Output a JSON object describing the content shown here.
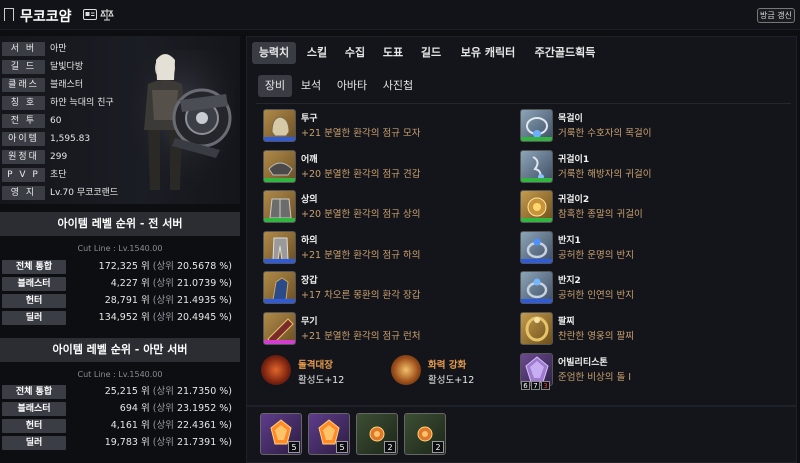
{
  "header": {
    "title": "무코코얌",
    "refresh_label": "방금 갱신"
  },
  "profile": {
    "rows": [
      {
        "label": "서 버",
        "value": "아만"
      },
      {
        "label": "길 드",
        "value": "달빛다방"
      },
      {
        "label": "클래스",
        "value": "블래스터"
      },
      {
        "label": "칭 호",
        "value": "하얀 늑대의 친구"
      },
      {
        "label": "전 투",
        "value": "60"
      },
      {
        "label": "아이템",
        "value": "1,595.83"
      },
      {
        "label": "원정대",
        "value": "299"
      },
      {
        "label": "P V P",
        "value": "초단"
      },
      {
        "label": "영 지",
        "value": "Lv.70 무코코랜드"
      }
    ]
  },
  "ranking_all": {
    "title": "아이템 레벨 순위 - 전 서버",
    "cutline": "Cut Line : Lv.1540.00",
    "rows": [
      {
        "label": "전체 통합",
        "rank": "172,325 위",
        "pct_label": "(상위",
        "pct": "20.5678 %)"
      },
      {
        "label": "블래스터",
        "rank": "4,227 위",
        "pct_label": "(상위",
        "pct": "21.0739 %)"
      },
      {
        "label": "헌터",
        "rank": "28,791 위",
        "pct_label": "(상위",
        "pct": "21.4935 %)"
      },
      {
        "label": "딜러",
        "rank": "134,952 위",
        "pct_label": "(상위",
        "pct": "20.4945 %)"
      }
    ]
  },
  "ranking_server": {
    "title": "아이템 레벨 순위 - 아만 서버",
    "cutline": "Cut Line : Lv.1540.00",
    "rows": [
      {
        "label": "전체 통합",
        "rank": "25,215 위",
        "pct_label": "(상위",
        "pct": "21.7350 %)"
      },
      {
        "label": "블래스터",
        "rank": "694 위",
        "pct_label": "(상위",
        "pct": "23.1952 %)"
      },
      {
        "label": "헌터",
        "rank": "4,161 위",
        "pct_label": "(상위",
        "pct": "22.4361 %)"
      },
      {
        "label": "딜러",
        "rank": "19,783 위",
        "pct_label": "(상위",
        "pct": "21.7391 %)"
      }
    ]
  },
  "tabs": [
    "능력치",
    "스킬",
    "수집",
    "도표",
    "길드",
    "보유 캐릭터",
    "주간골드획득"
  ],
  "subtabs": [
    "장비",
    "보석",
    "아바타",
    "사진첩"
  ],
  "equipment_left": [
    {
      "name": "투구",
      "desc": "+21 분열한 환각의 점규 모자",
      "quality_color": "#2e5bdc"
    },
    {
      "name": "어깨",
      "desc": "+20 분열한 환각의 점규 견갑",
      "quality_color": "#32b441"
    },
    {
      "name": "상의",
      "desc": "+20 분열한 환각의 점규 상의",
      "quality_color": "#32b441"
    },
    {
      "name": "하의",
      "desc": "+21 분열한 환각의 점규 하의",
      "quality_color": "#2e5bdc"
    },
    {
      "name": "장갑",
      "desc": "+17 차오른 몽환의 환각 장갑",
      "quality_color": "#2e5bdc"
    },
    {
      "name": "무기",
      "desc": "+21 분열한 환각의 점규 런처",
      "quality_color": "#d23fd0"
    }
  ],
  "equipment_right": [
    {
      "name": "목걸이",
      "desc": "거룩한 수호자의 목걸이",
      "quality_color": "#32b441"
    },
    {
      "name": "귀걸이1",
      "desc": "거룩한 해방자의 귀걸이",
      "quality_color": "#32b441"
    },
    {
      "name": "귀걸이2",
      "desc": "참혹한 종말의 귀걸이",
      "quality_color": "#32b441"
    },
    {
      "name": "반지1",
      "desc": "공허한 운명의 반지",
      "quality_color": "#2e5bdc"
    },
    {
      "name": "반지2",
      "desc": "공허한 인연의 반지",
      "quality_color": "#2e5bdc"
    },
    {
      "name": "팔찌",
      "desc": "찬란한 영웅의 팔찌",
      "quality_color": ""
    }
  ],
  "engravings": [
    {
      "name": "돌격대장",
      "level": "활성도+12"
    },
    {
      "name": "화력 강화",
      "level": "활성도+12"
    }
  ],
  "ability_stone": {
    "name": "어빌리티스톤",
    "desc": "준엄한 비상의 돌 I",
    "nodes": [
      "6",
      "7",
      "3"
    ]
  },
  "gems": [
    {
      "level": "5",
      "color": "purple"
    },
    {
      "level": "5",
      "color": "purple"
    },
    {
      "level": "2",
      "color": "green"
    },
    {
      "level": "2",
      "color": "green"
    }
  ],
  "colors": {
    "background": "#0d0e12",
    "panel": "#14151a",
    "label_bg": "#3b3d45",
    "desc_gold": "#c8a070",
    "engraving_orange": "#e39a4d"
  }
}
